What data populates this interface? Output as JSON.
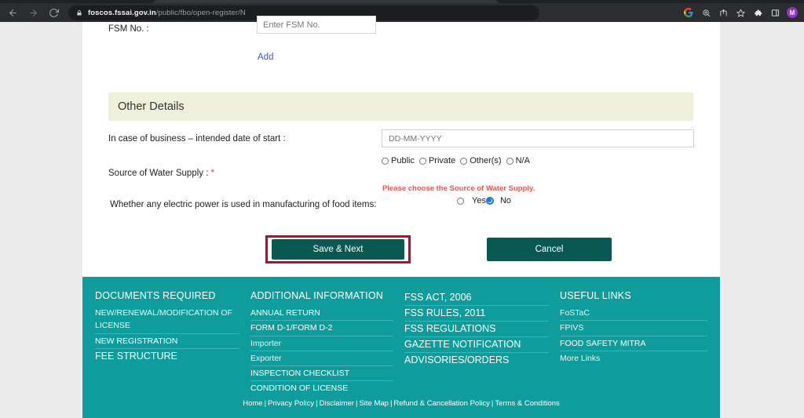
{
  "browser": {
    "url_host": "foscos.fssai.gov.in",
    "url_path": "/public/fbo/open-register/N",
    "back_icon": "back-arrow-icon",
    "forward_icon": "forward-arrow-icon",
    "reload_icon": "reload-icon",
    "lock_icon": "lock-icon",
    "toolbar_icons": [
      "google-icon",
      "zoom-icon",
      "share-icon",
      "bookmark-star-icon",
      "extensions-puzzle-icon",
      "side-panel-icon"
    ],
    "avatar_initial": "M"
  },
  "form": {
    "fsm_label": "FSM No. :",
    "fsm_placeholder": "Enter FSM No.",
    "add_label": "Add",
    "section_title": "Other Details",
    "date_label": "In case of business – intended date of start :",
    "date_placeholder": "DD-MM-YYYY",
    "water_label": "Source of Water Supply : ",
    "water_required_mark": "*",
    "water_options": [
      "Public",
      "Private",
      "Other(s)",
      "N/A"
    ],
    "water_error": "Please choose the Source of Water Supply.",
    "power_label": "Whether any electric power is used in manufacturing of food items:",
    "power_yes": "Yes",
    "power_no": "No",
    "save_label": "Save & Next",
    "cancel_label": "Cancel"
  },
  "footer": {
    "columns": [
      {
        "heading": "DOCUMENTS REQUIRED",
        "items": [
          {
            "text": "NEW/RENEWAL/MODIFICATION OF LICENSE",
            "style": "small"
          },
          {
            "text": "NEW REGISTRATION",
            "style": "mid"
          },
          {
            "text": "FEE STRUCTURE",
            "style": "big"
          }
        ]
      },
      {
        "heading": "ADDITIONAL INFORMATION",
        "items": [
          {
            "text": "ANNUAL RETURN",
            "style": "mid"
          },
          {
            "text": "FORM D-1/FORM D-2",
            "style": "mid"
          },
          {
            "text": "Importer",
            "style": "sent"
          },
          {
            "text": "Exporter",
            "style": "sent"
          },
          {
            "text": "INSPECTION CHECKLIST",
            "style": "mid"
          },
          {
            "text": "CONDITION OF LICENSE",
            "style": "mid"
          }
        ]
      },
      {
        "heading": "",
        "items": [
          {
            "text": "FSS ACT, 2006",
            "style": "big"
          },
          {
            "text": "FSS RULES, 2011",
            "style": "big"
          },
          {
            "text": "FSS REGULATIONS",
            "style": "big"
          },
          {
            "text": "GAZETTE NOTIFICATION",
            "style": "big"
          },
          {
            "text": "ADVISORIES/ORDERS",
            "style": "big"
          }
        ]
      },
      {
        "heading": "USEFUL LINKS",
        "items": [
          {
            "text": "FoSTaC",
            "style": "sent"
          },
          {
            "text": "FPIVS",
            "style": "sent"
          },
          {
            "text": "FOOD SAFETY MITRA",
            "style": "mid"
          },
          {
            "text": "More Links",
            "style": "sent"
          }
        ]
      }
    ],
    "bottom_links": [
      "Home",
      "Privacy Policy",
      "Disclaimer",
      "Site Map",
      "Refund & Cancellation Policy",
      "Terms & Conditions"
    ],
    "separator": "|"
  },
  "colors": {
    "footer_teal": "#0e9c9c",
    "button_teal": "#0a5852",
    "highlight_red": "#8f1f31",
    "section_cream": "#eff0dc",
    "error_red": "#e8564e",
    "link_blue": "#3b56d6",
    "radio_blue": "#1a73e8"
  }
}
